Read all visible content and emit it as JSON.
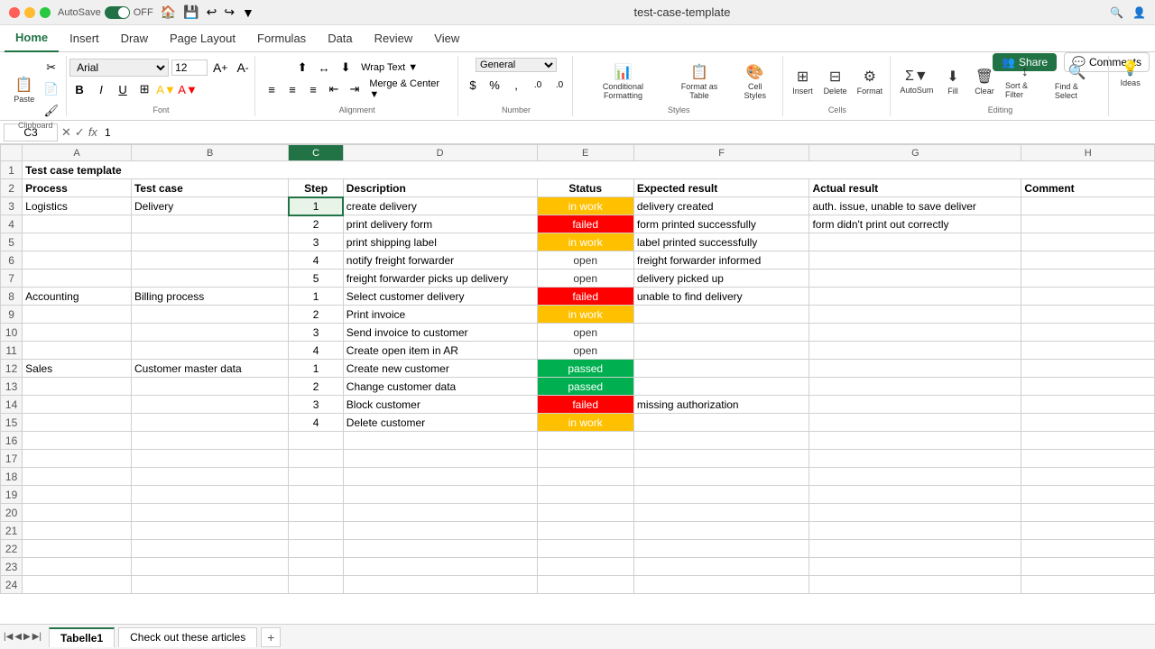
{
  "titleBar": {
    "filename": "test-case-template",
    "autosave": "AutoSave",
    "autosave_on": "OFF",
    "search": "🔍",
    "account": "👤"
  },
  "ribbon": {
    "tabs": [
      "Home",
      "Insert",
      "Draw",
      "Page Layout",
      "Formulas",
      "Data",
      "Review",
      "View"
    ],
    "active_tab": "Home",
    "font": "Arial",
    "font_size": "12",
    "share_label": "Share",
    "comments_label": "Comments",
    "ideas_label": "Ideas",
    "format_label": "Format"
  },
  "formulaBar": {
    "cell_ref": "C3",
    "value": "1"
  },
  "columns": {
    "headers": [
      "A",
      "B",
      "C",
      "D",
      "E",
      "F",
      "G",
      "H"
    ],
    "widths": [
      90,
      130,
      45,
      160,
      80,
      145,
      175,
      110
    ]
  },
  "rows": [
    {
      "num": 1,
      "cells": [
        {
          "text": "Test case template",
          "class": "title-cell bold",
          "colspan": 7
        }
      ]
    },
    {
      "num": 2,
      "cells": [
        {
          "text": "Process",
          "class": "bold"
        },
        {
          "text": "Test case",
          "class": "bold"
        },
        {
          "text": "Step",
          "class": "bold center"
        },
        {
          "text": "Description",
          "class": "bold"
        },
        {
          "text": "Status",
          "class": "bold center"
        },
        {
          "text": "Expected result",
          "class": "bold"
        },
        {
          "text": "Actual result",
          "class": "bold"
        },
        {
          "text": "Comment",
          "class": "bold"
        }
      ]
    },
    {
      "num": 3,
      "cells": [
        {
          "text": "Logistics"
        },
        {
          "text": "Delivery"
        },
        {
          "text": "1",
          "class": "center selected-cell"
        },
        {
          "text": "create delivery"
        },
        {
          "text": "in work",
          "class": "status-inwork"
        },
        {
          "text": "delivery created"
        },
        {
          "text": "auth. issue, unable to save deliver"
        },
        {
          "text": ""
        }
      ]
    },
    {
      "num": 4,
      "cells": [
        {
          "text": ""
        },
        {
          "text": ""
        },
        {
          "text": "2",
          "class": "center"
        },
        {
          "text": "print delivery form"
        },
        {
          "text": "failed",
          "class": "status-failed"
        },
        {
          "text": "form printed successfully"
        },
        {
          "text": "form didn't print out correctly"
        },
        {
          "text": ""
        }
      ]
    },
    {
      "num": 5,
      "cells": [
        {
          "text": ""
        },
        {
          "text": ""
        },
        {
          "text": "3",
          "class": "center"
        },
        {
          "text": "print shipping label"
        },
        {
          "text": "in work",
          "class": "status-inwork"
        },
        {
          "text": "label printed successfully"
        },
        {
          "text": ""
        },
        {
          "text": ""
        }
      ]
    },
    {
      "num": 6,
      "cells": [
        {
          "text": ""
        },
        {
          "text": ""
        },
        {
          "text": "4",
          "class": "center"
        },
        {
          "text": "notify freight forwarder"
        },
        {
          "text": "open",
          "class": "status-open"
        },
        {
          "text": "freight forwarder informed"
        },
        {
          "text": ""
        },
        {
          "text": ""
        }
      ]
    },
    {
      "num": 7,
      "cells": [
        {
          "text": ""
        },
        {
          "text": ""
        },
        {
          "text": "5",
          "class": "center"
        },
        {
          "text": "freight forwarder picks up delivery"
        },
        {
          "text": "open",
          "class": "status-open"
        },
        {
          "text": "delivery picked up"
        },
        {
          "text": ""
        },
        {
          "text": ""
        }
      ]
    },
    {
      "num": 8,
      "cells": [
        {
          "text": "Accounting"
        },
        {
          "text": "Billing process"
        },
        {
          "text": "1",
          "class": "center"
        },
        {
          "text": "Select customer delivery"
        },
        {
          "text": "failed",
          "class": "status-failed"
        },
        {
          "text": "unable to find delivery"
        },
        {
          "text": ""
        },
        {
          "text": ""
        }
      ]
    },
    {
      "num": 9,
      "cells": [
        {
          "text": ""
        },
        {
          "text": ""
        },
        {
          "text": "2",
          "class": "center"
        },
        {
          "text": "Print invoice"
        },
        {
          "text": "in work",
          "class": "status-inwork"
        },
        {
          "text": ""
        },
        {
          "text": ""
        },
        {
          "text": ""
        }
      ]
    },
    {
      "num": 10,
      "cells": [
        {
          "text": ""
        },
        {
          "text": ""
        },
        {
          "text": "3",
          "class": "center"
        },
        {
          "text": "Send invoice to customer"
        },
        {
          "text": "open",
          "class": "status-open"
        },
        {
          "text": ""
        },
        {
          "text": ""
        },
        {
          "text": ""
        }
      ]
    },
    {
      "num": 11,
      "cells": [
        {
          "text": ""
        },
        {
          "text": ""
        },
        {
          "text": "4",
          "class": "center"
        },
        {
          "text": "Create open item in AR"
        },
        {
          "text": "open",
          "class": "status-open"
        },
        {
          "text": ""
        },
        {
          "text": ""
        },
        {
          "text": ""
        }
      ]
    },
    {
      "num": 12,
      "cells": [
        {
          "text": "Sales"
        },
        {
          "text": "Customer master data"
        },
        {
          "text": "1",
          "class": "center"
        },
        {
          "text": "Create new customer"
        },
        {
          "text": "passed",
          "class": "status-passed"
        },
        {
          "text": ""
        },
        {
          "text": ""
        },
        {
          "text": ""
        }
      ]
    },
    {
      "num": 13,
      "cells": [
        {
          "text": ""
        },
        {
          "text": ""
        },
        {
          "text": "2",
          "class": "center"
        },
        {
          "text": "Change customer data"
        },
        {
          "text": "passed",
          "class": "status-passed"
        },
        {
          "text": ""
        },
        {
          "text": ""
        },
        {
          "text": ""
        }
      ]
    },
    {
      "num": 14,
      "cells": [
        {
          "text": ""
        },
        {
          "text": ""
        },
        {
          "text": "3",
          "class": "center"
        },
        {
          "text": "Block customer"
        },
        {
          "text": "failed",
          "class": "status-failed"
        },
        {
          "text": "missing authorization"
        },
        {
          "text": ""
        },
        {
          "text": ""
        }
      ]
    },
    {
      "num": 15,
      "cells": [
        {
          "text": ""
        },
        {
          "text": ""
        },
        {
          "text": "4",
          "class": "center"
        },
        {
          "text": "Delete customer"
        },
        {
          "text": "in work",
          "class": "status-inwork"
        },
        {
          "text": ""
        },
        {
          "text": ""
        },
        {
          "text": ""
        }
      ]
    },
    {
      "num": 16,
      "cells": [
        {
          "text": ""
        },
        {
          "text": ""
        },
        {
          "text": ""
        },
        {
          "text": ""
        },
        {
          "text": ""
        },
        {
          "text": ""
        },
        {
          "text": ""
        },
        {
          "text": ""
        }
      ]
    },
    {
      "num": 17,
      "cells": [
        {
          "text": ""
        },
        {
          "text": ""
        },
        {
          "text": ""
        },
        {
          "text": ""
        },
        {
          "text": ""
        },
        {
          "text": ""
        },
        {
          "text": ""
        },
        {
          "text": ""
        }
      ]
    },
    {
      "num": 18,
      "cells": [
        {
          "text": ""
        },
        {
          "text": ""
        },
        {
          "text": ""
        },
        {
          "text": ""
        },
        {
          "text": ""
        },
        {
          "text": ""
        },
        {
          "text": ""
        },
        {
          "text": ""
        }
      ]
    },
    {
      "num": 19,
      "cells": [
        {
          "text": ""
        },
        {
          "text": ""
        },
        {
          "text": ""
        },
        {
          "text": ""
        },
        {
          "text": ""
        },
        {
          "text": ""
        },
        {
          "text": ""
        },
        {
          "text": ""
        }
      ]
    },
    {
      "num": 20,
      "cells": [
        {
          "text": ""
        },
        {
          "text": ""
        },
        {
          "text": ""
        },
        {
          "text": ""
        },
        {
          "text": ""
        },
        {
          "text": ""
        },
        {
          "text": ""
        },
        {
          "text": ""
        }
      ]
    },
    {
      "num": 21,
      "cells": [
        {
          "text": ""
        },
        {
          "text": ""
        },
        {
          "text": ""
        },
        {
          "text": ""
        },
        {
          "text": ""
        },
        {
          "text": ""
        },
        {
          "text": ""
        },
        {
          "text": ""
        }
      ]
    },
    {
      "num": 22,
      "cells": [
        {
          "text": ""
        },
        {
          "text": ""
        },
        {
          "text": ""
        },
        {
          "text": ""
        },
        {
          "text": ""
        },
        {
          "text": ""
        },
        {
          "text": ""
        },
        {
          "text": ""
        }
      ]
    },
    {
      "num": 23,
      "cells": [
        {
          "text": ""
        },
        {
          "text": ""
        },
        {
          "text": ""
        },
        {
          "text": ""
        },
        {
          "text": ""
        },
        {
          "text": ""
        },
        {
          "text": ""
        },
        {
          "text": ""
        }
      ]
    },
    {
      "num": 24,
      "cells": [
        {
          "text": ""
        },
        {
          "text": ""
        },
        {
          "text": ""
        },
        {
          "text": ""
        },
        {
          "text": ""
        },
        {
          "text": ""
        },
        {
          "text": ""
        },
        {
          "text": ""
        }
      ]
    }
  ],
  "sheets": [
    {
      "label": "Tabelle1",
      "active": true
    },
    {
      "label": "Check out these articles",
      "active": false
    }
  ]
}
